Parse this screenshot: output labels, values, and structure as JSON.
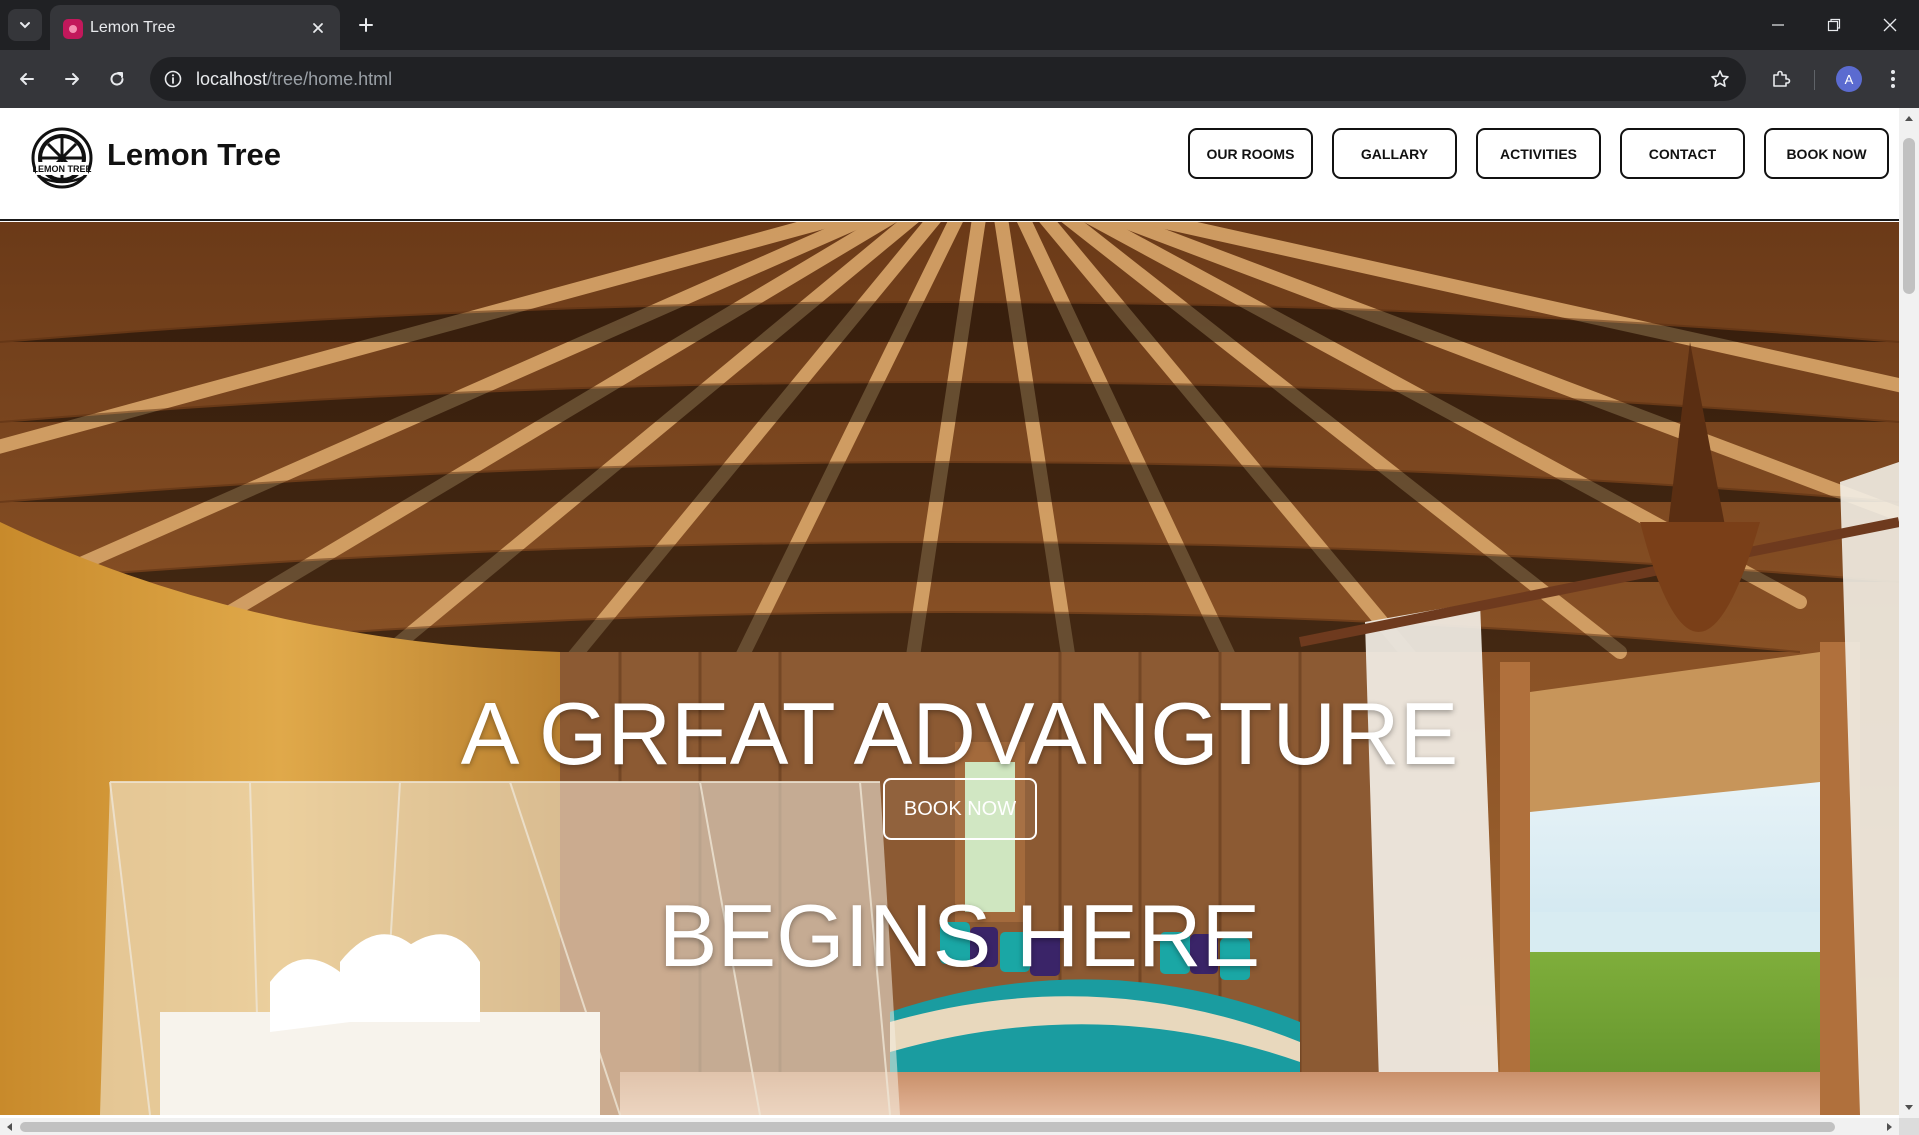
{
  "browser": {
    "tab_title": "Lemon Tree",
    "url_host": "localhost",
    "url_path": "/tree/home.html",
    "profile_initial": "A"
  },
  "site": {
    "brand": "Lemon Tree",
    "logo_text": "LEMON TREE",
    "nav": [
      "OUR ROOMS",
      "GALLARY",
      "ACTIVITIES",
      "CONTACT",
      "BOOK NOW"
    ]
  },
  "hero": {
    "title_line1": "A GREAT ADVANGTURE",
    "title_line2": "BEGINS HERE",
    "cta": "BOOK NOW"
  },
  "colors": {
    "chrome_dark": "#202124",
    "chrome_mid": "#35363a",
    "favicon": "#c2185b",
    "avatar": "#5b6bd0",
    "nav_border": "#111111"
  }
}
